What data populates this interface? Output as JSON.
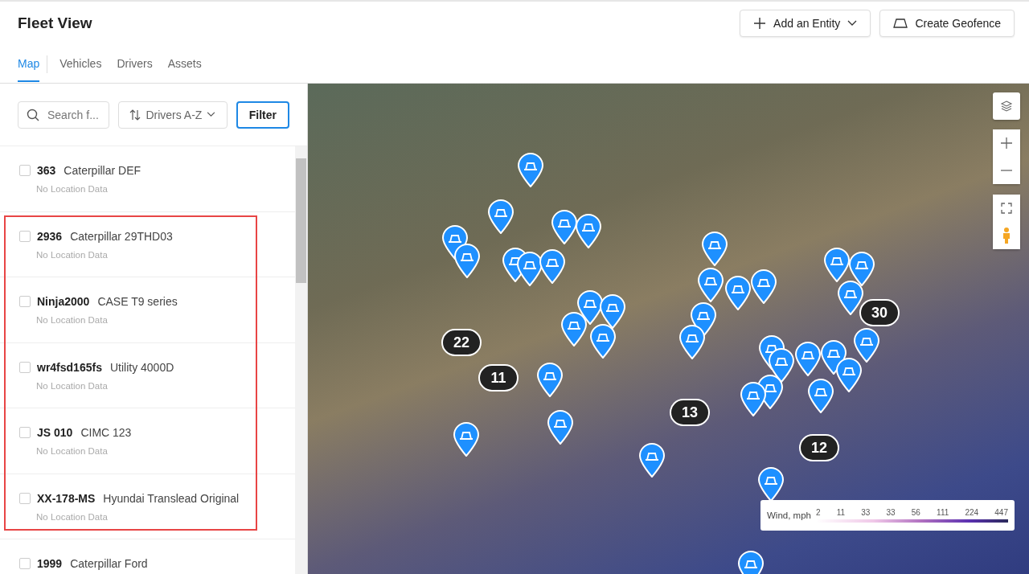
{
  "header": {
    "title": "Fleet View",
    "actions": [
      {
        "kind": "add",
        "label": "Add an Entity"
      },
      {
        "kind": "geofence",
        "label": "Create Geofence"
      }
    ]
  },
  "tabs": [
    {
      "label": "Map",
      "selected": true
    },
    {
      "label": "Vehicles",
      "selected": false
    },
    {
      "label": "Drivers",
      "selected": false
    },
    {
      "label": "Assets",
      "selected": false
    }
  ],
  "toolbar": {
    "search": {
      "placeholder": "Search f..."
    },
    "sort": {
      "label": "Drivers A-Z"
    },
    "filter": {
      "label": "Filter"
    }
  },
  "assets": [
    {
      "id": "363",
      "name": "Caterpillar DEF",
      "status": "No Location Data",
      "checked": false
    },
    {
      "id": "2936",
      "name": "Caterpillar 29THD03",
      "status": "No Location Data",
      "checked": false
    },
    {
      "id": "Ninja2000",
      "name": "CASE T9 series",
      "status": "No Location Data",
      "checked": false
    },
    {
      "id": "wr4fsd165fs",
      "name": "Utility 4000D",
      "status": "No Location Data",
      "checked": false
    },
    {
      "id": "JS 010",
      "name": "CIMC 123",
      "status": "No Location Data",
      "checked": false
    },
    {
      "id": "XX-178-MS",
      "name": "Hyundai Translead Original",
      "status": "No Location Data",
      "checked": false
    },
    {
      "id": "1999",
      "name": "Caterpillar Ford",
      "checked": false
    }
  ],
  "map": {
    "clusters": [
      "22",
      "11",
      "13",
      "12",
      "30"
    ],
    "legend": {
      "label": "Wind, mph",
      "ticks": [
        "2",
        "11",
        "33",
        "33",
        "56",
        "111",
        "224",
        "447"
      ]
    }
  }
}
